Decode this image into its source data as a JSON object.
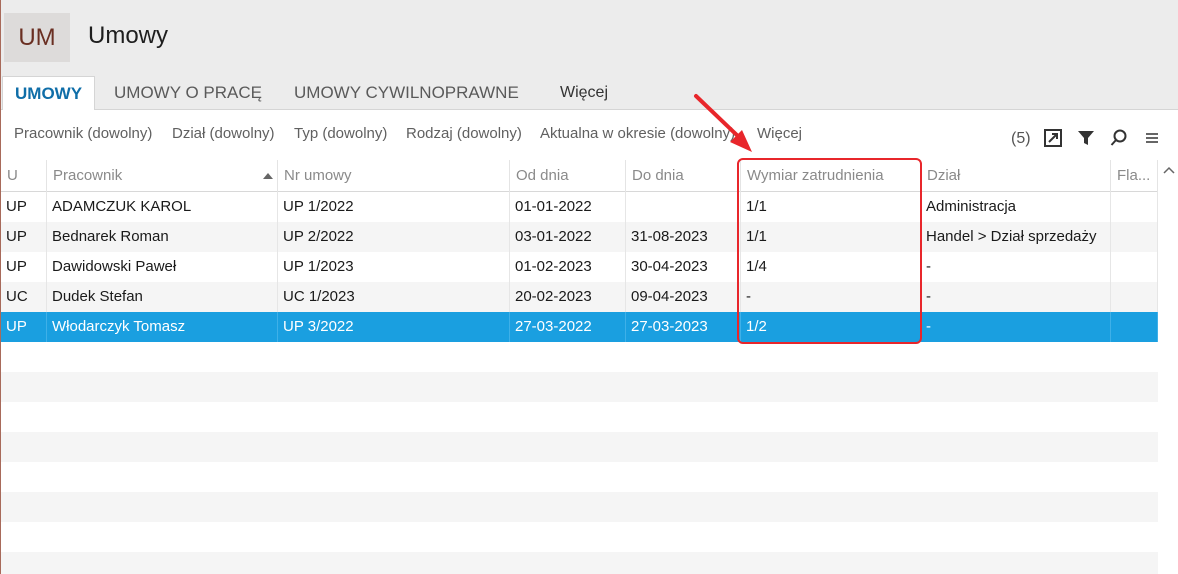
{
  "app": {
    "badge": "UM",
    "title": "Umowy"
  },
  "tabs": [
    {
      "label": "UMOWY",
      "active": true
    },
    {
      "label": "UMOWY O PRACĘ",
      "active": false
    },
    {
      "label": "UMOWY CYWILNOPRAWNE",
      "active": false
    },
    {
      "label": "Więcej",
      "active": false
    }
  ],
  "filters": [
    "Pracownik (dowolny)",
    "Dział (dowolny)",
    "Typ (dowolny)",
    "Rodzaj (dowolny)",
    "Aktualna w okresie (dowolny)",
    "Więcej"
  ],
  "toolbar": {
    "count": "(5)",
    "icons": [
      "export-icon",
      "filter-icon",
      "search-icon",
      "menu-icon"
    ]
  },
  "table": {
    "columns": [
      "U",
      "Pracownik",
      "Nr umowy",
      "Od dnia",
      "Do dnia",
      "Wymiar zatrudnienia",
      "Dział",
      "Fla..."
    ],
    "sorted_column": "Pracownik",
    "sort_direction": "ascending",
    "rows": [
      {
        "u": "UP",
        "pracownik": "ADAMCZUK KAROL",
        "nr": "UP 1/2022",
        "od": "01-01-2022",
        "do": "",
        "wymiar": "1/1",
        "dzial": "Administracja",
        "flag": ""
      },
      {
        "u": "UP",
        "pracownik": "Bednarek Roman",
        "nr": "UP 2/2022",
        "od": "03-01-2022",
        "do": "31-08-2023",
        "wymiar": "1/1",
        "dzial": "Handel > Dział sprzedaży",
        "flag": ""
      },
      {
        "u": "UP",
        "pracownik": "Dawidowski Paweł",
        "nr": "UP 1/2023",
        "od": "01-02-2023",
        "do": "30-04-2023",
        "wymiar": "1/4",
        "dzial": "-",
        "flag": ""
      },
      {
        "u": "UC",
        "pracownik": "Dudek Stefan",
        "nr": "UC 1/2023",
        "od": "20-02-2023",
        "do": "09-04-2023",
        "wymiar": "-",
        "dzial": "-",
        "flag": ""
      },
      {
        "u": "UP",
        "pracownik": "Włodarczyk Tomasz",
        "nr": "UP 3/2022",
        "od": "27-03-2022",
        "do": "27-03-2023",
        "wymiar": "1/2",
        "dzial": "-",
        "flag": "",
        "selected": true
      }
    ]
  },
  "colors": {
    "accent": "#0f6ea8",
    "selection": "#1a9fe0",
    "annotation": "#e8262b",
    "badge_text": "#6a2f22"
  }
}
